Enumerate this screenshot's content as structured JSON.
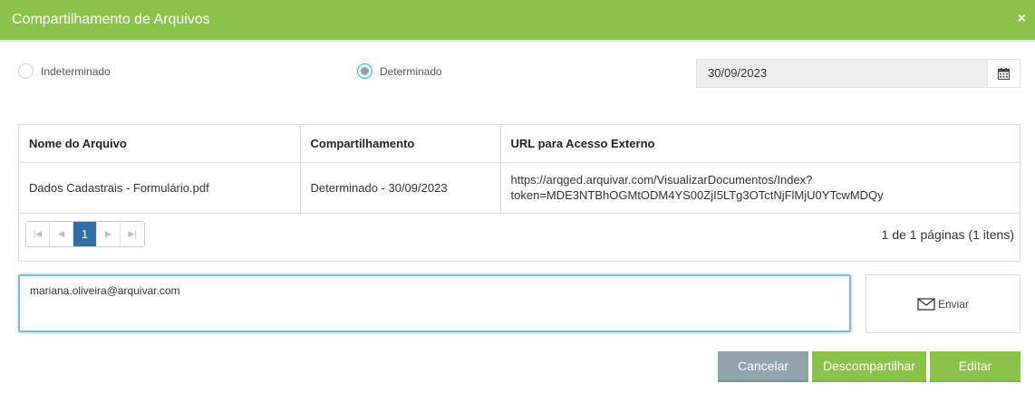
{
  "header": {
    "title": "Compartilhamento de Arquivos",
    "close": "×"
  },
  "options": {
    "indeterminate_label": "Indeterminado",
    "determinate_label": "Determinado",
    "selected": "Determinado",
    "date_value": "30/09/2023"
  },
  "table": {
    "headers": [
      "Nome do Arquivo",
      "Compartilhamento",
      "URL para Acesso Externo"
    ],
    "rows": [
      {
        "file": "Dados Cadastrais - Formulário.pdf",
        "sharing": "Determinado - 30/09/2023",
        "url_line1": "https://arqged.arquivar.com/VisualizarDocumentos/Index?",
        "url_line2": "token=MDE3NTBhOGMtODM4YS00ZjI5LTg3OTctNjFlMjU0YTcwMDQy"
      }
    ]
  },
  "pager": {
    "current": "1",
    "info": "1 de 1 páginas (1 itens)"
  },
  "email": {
    "value": "mariana.oliveira@arquivar.com"
  },
  "send": {
    "label": "Enviar",
    "icon": "envelope-icon"
  },
  "actions": {
    "cancel": "Cancelar",
    "unshare": "Descompartilhar",
    "edit": "Editar"
  },
  "colors": {
    "accent": "#8bc34a",
    "cancel": "#90a4ae",
    "pager_active": "#2f6fa7"
  }
}
